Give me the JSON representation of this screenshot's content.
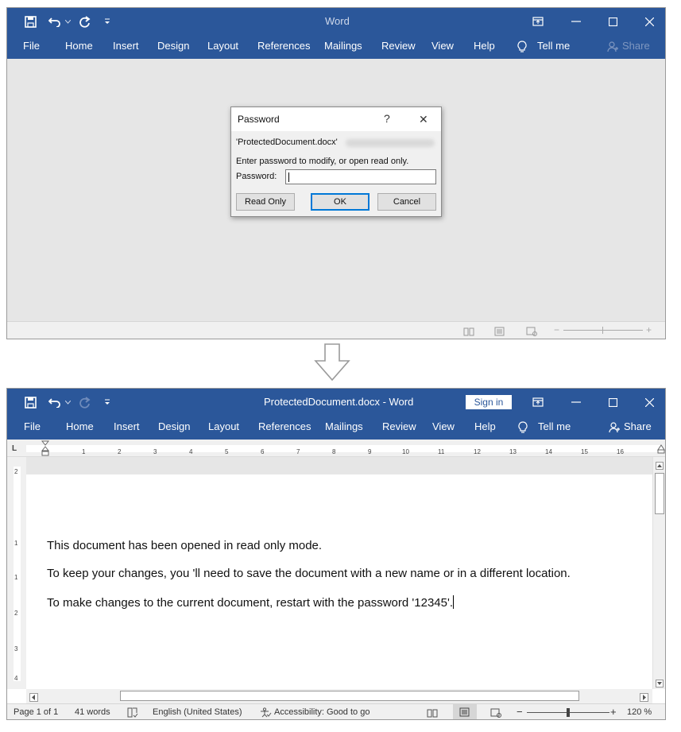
{
  "before": {
    "app_title": "Word",
    "menu": [
      "File",
      "Home",
      "Insert",
      "Design",
      "Layout",
      "References",
      "Mailings",
      "Review",
      "View",
      "Help"
    ],
    "tell_me": "Tell me",
    "share": "Share",
    "dialog": {
      "title": "Password",
      "help": "?",
      "close": "✕",
      "filename": "'ProtectedDocument.docx'",
      "message": "Enter password to modify, or open read only.",
      "password_label": "Password:",
      "password_value": "",
      "read_only": "Read Only",
      "ok": "OK",
      "cancel": "Cancel"
    }
  },
  "after": {
    "title": "ProtectedDocument.docx  -  Word",
    "sign_in": "Sign in",
    "menu": [
      "File",
      "Home",
      "Insert",
      "Design",
      "Layout",
      "References",
      "Mailings",
      "Review",
      "View",
      "Help"
    ],
    "tell_me": "Tell me",
    "share": "Share",
    "ruler_numbers": [
      "1",
      "2",
      "3",
      "4",
      "5",
      "6",
      "7",
      "8",
      "9",
      "10",
      "11",
      "12",
      "13",
      "14",
      "15",
      "16"
    ],
    "vruler_numbers": [
      "2",
      "1",
      "1",
      "2",
      "3",
      "4"
    ],
    "paragraphs": [
      "This document has been opened in read only mode.",
      "To keep your changes, you 'll need to save the document with a new name or in a different location.",
      "To make changes to the current document, restart with the password '12345'."
    ],
    "status": {
      "page": "Page 1 of 1",
      "words": "41 words",
      "language": "English (United States)",
      "accessibility": "Accessibility: Good to go",
      "zoom": "120 %",
      "zoom_minus": "−",
      "zoom_plus": "+"
    }
  },
  "colors": {
    "ribbon": "#2b579a",
    "status_bg": "#f0f0f0",
    "ok_border": "#0078d7"
  }
}
